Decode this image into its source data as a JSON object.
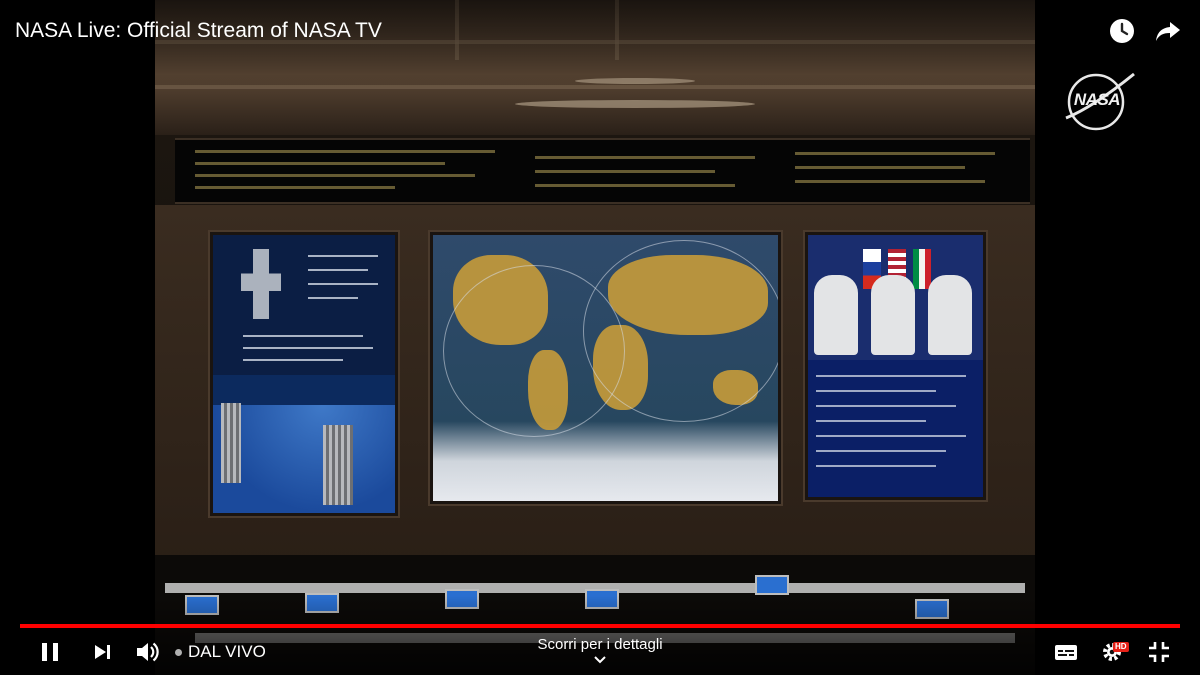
{
  "video": {
    "title": "NASA Live: Official Stream of NASA TV",
    "channel_logo_text": "NASA"
  },
  "top_actions": {
    "watch_later_icon": "clock-icon",
    "share_icon": "share-arrow-icon"
  },
  "progress": {
    "fraction": 1.0,
    "color": "#ff0000"
  },
  "controls": {
    "play_pause_icon": "pause-icon",
    "next_icon": "skip-next-icon",
    "volume_icon": "volume-icon",
    "live_label": "DAL VIVO",
    "scroll_hint": "Scorri per i dettagli",
    "subtitles_icon": "subtitles-icon",
    "settings_icon": "gear-icon",
    "quality_badge": "HD",
    "fullscreen_icon": "exit-fullscreen-icon"
  },
  "colors": {
    "accent": "#ff0000",
    "hd_badge": "#e62117"
  }
}
